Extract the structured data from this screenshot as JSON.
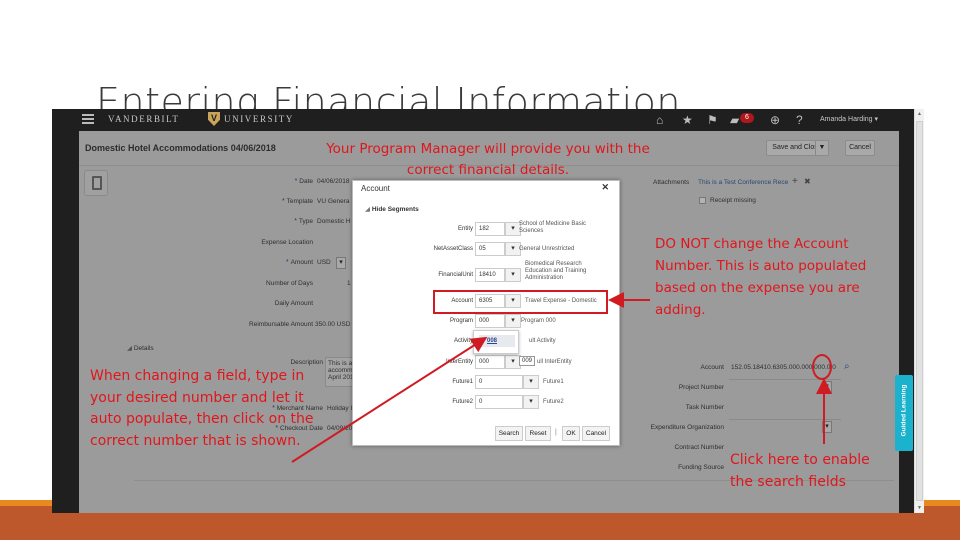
{
  "slide": {
    "title": "Entering Financial Information"
  },
  "topnav": {
    "brand_left": "VANDERBILT",
    "brand_right": "UNIVERSITY",
    "icons": [
      "home-icon",
      "favorites-star-icon",
      "flag-icon",
      "notifications-icon",
      "accessibility-icon",
      "help-icon"
    ],
    "notification_count": "6",
    "user_name": "Amanda Harding ▾"
  },
  "page": {
    "title": "Domestic Hotel Accommodations 04/06/2018",
    "buttons": {
      "save_and_close": "Save and Close",
      "save_menu": "▼",
      "cancel": "Cancel"
    },
    "fields_left": [
      {
        "label": "Date",
        "required": true,
        "value": "04/06/2018"
      },
      {
        "label": "Template",
        "required": true,
        "value": "VU Genera"
      },
      {
        "label": "Type",
        "required": true,
        "value": "Domestic H"
      },
      {
        "label": "Expense Location",
        "required": false,
        "value": ""
      },
      {
        "label": "Amount",
        "required": true,
        "value": "USD"
      },
      {
        "label": "Number of Days",
        "required": false,
        "value": "1"
      },
      {
        "label": "Daily Amount",
        "required": false,
        "value": ""
      },
      {
        "label": "Reimbursable Amount",
        "required": false,
        "value": "350.00 USD"
      }
    ],
    "details_toggle": "Details",
    "details_fields": [
      {
        "label": "Description",
        "required": false,
        "value": "This is a accomm April 201"
      },
      {
        "label": "Merchant Name",
        "required": true,
        "value": "Holiday I"
      },
      {
        "label": "Checkout Date",
        "required": true,
        "value": "04/09/20"
      }
    ],
    "attachments": {
      "label": "Attachments",
      "value": "This is a Test Conference Rece",
      "add": "+",
      "remove": "✖"
    },
    "receipt_missing": "Receipt missing",
    "fields_right": [
      {
        "label": "Account",
        "value": "152.05.18410.6305.000.000.000.0.0"
      },
      {
        "label": "Project Number",
        "value": ""
      },
      {
        "label": "Task Number",
        "value": ""
      },
      {
        "label": "Expenditure Organization",
        "value": ""
      },
      {
        "label": "Contract Number",
        "value": ""
      },
      {
        "label": "Funding Source",
        "value": ""
      }
    ]
  },
  "dialog": {
    "title": "Account",
    "close": "✕",
    "hide_segments": "Hide Segments",
    "segments": [
      {
        "label": "Entity",
        "value": "182",
        "desc": "School of Medicine Basic Sciences"
      },
      {
        "label": "NetAssetClass",
        "value": "05",
        "desc": "General Unrestricted"
      },
      {
        "label": "FinancialUnit",
        "value": "18410",
        "desc": "Biomedical Research Education and Training Administration"
      },
      {
        "label": "Account",
        "value": "6305",
        "desc": "Travel Expense - Domestic"
      },
      {
        "label": "Program",
        "value": "000",
        "desc": "Program 000"
      },
      {
        "label": "Activity",
        "value": "",
        "desc": "ult Activity"
      },
      {
        "label": "InterEntity",
        "value": "000",
        "desc": "ull InterEntity"
      },
      {
        "label": "Future1",
        "value": "0",
        "desc": "Future1"
      },
      {
        "label": "Future2",
        "value": "0",
        "desc": "Future2"
      }
    ],
    "autocomplete_option": "008",
    "tooltip": "009",
    "buttons": {
      "search": "Search",
      "reset": "Reset",
      "ok": "OK",
      "cancel": "Cancel"
    }
  },
  "guided_learning": "Guided Learning",
  "annotations": {
    "program_manager": "Your Program Manager will provide you with the correct financial details.",
    "do_not_change": "DO NOT change the Account Number. This is auto populated based on the expense you are adding.",
    "changing_field": "When changing a field, type in your desired number and let it auto populate, then click on the correct number that is shown.",
    "click_here": "Click here to enable the search fields",
    "color": "#e0161c"
  }
}
